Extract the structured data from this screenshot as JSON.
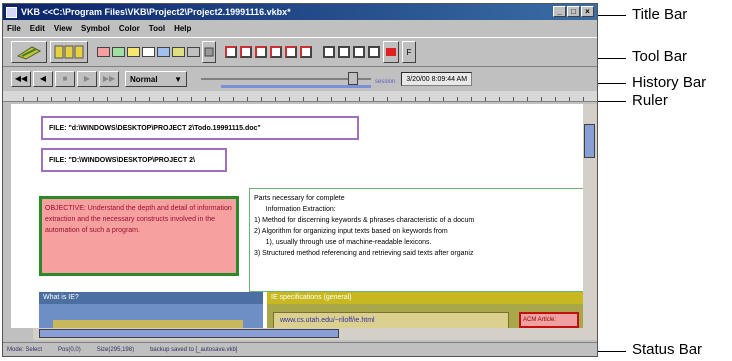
{
  "window": {
    "title": "VKB  <<C:\\Program Files\\VKB\\Project2\\Project2.19991116.vkbx*",
    "controls": [
      "_",
      "□",
      "×"
    ]
  },
  "menu": [
    "File",
    "Edit",
    "View",
    "Symbol",
    "Color",
    "Tool",
    "Help"
  ],
  "toolbar": {
    "swatch_colors": [
      "#f4a0a0",
      "#a0e0a0",
      "#f4e870",
      "#ffffff",
      "#a0c0f0",
      "#e0e080",
      "#c0c0c0"
    ],
    "frame_colors": [
      "#cc3030",
      "#cc3030",
      "#cc3030",
      "#cc3030",
      "#cc3030",
      "#cc3030"
    ],
    "font_button": "F"
  },
  "history": {
    "buttons": [
      "◀◀",
      "◀",
      "■",
      "▶",
      "▶▶"
    ],
    "mode_label": "Normal",
    "session_label": "session",
    "timestamp": "3/20/00 8:09:44 AM",
    "slider_fraction": 0.92
  },
  "canvas": {
    "file1": "FILE: \"d:\\WINDOWS\\DESKTOP\\PROJECT 2\\Todo.19991115.doc\"",
    "file2": "FILE: \"D:\\WINDOWS\\DESKTOP\\PROJECT 2\\",
    "objective": "OBJECTIVE: Understand the depth and detail of information extraction and the necessary constructs involved in the automation of such a program.",
    "parts": [
      "Parts necessary for complete",
      "      Information Extraction:",
      "1)  Method for discerning keywords & phrases characteristic of a docum",
      "2)  Algorithm for organizing input texts based on keywords from",
      "      1), usually through use of machine-readable lexicons.",
      "3)  Structured method referencing and retrieving said texts after organiz"
    ],
    "whatis_header": "What is IE?",
    "iespec_header": "IE specifications (general)",
    "iespec_link": "www.cs.utah.edu/~riloff/ie.html",
    "acm_label": "ACM Article:"
  },
  "status": {
    "mode": "Mode: Select",
    "pos": "Pos(0,0)",
    "size": "Size(295,198)",
    "backup": "backup saved to [_autosave.vkb]"
  },
  "callouts": {
    "title_bar": "Title Bar",
    "tool_bar": "Tool Bar",
    "history_bar": "History Bar",
    "ruler": "Ruler",
    "status_bar": "Status Bar"
  }
}
